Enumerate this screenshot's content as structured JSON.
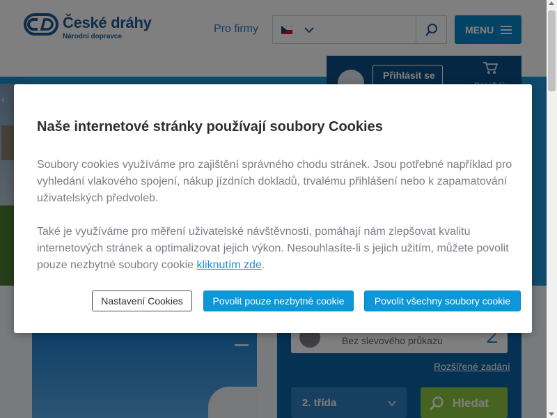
{
  "header": {
    "logo_title": "České dráhy",
    "logo_subtitle": "Národní dopravce",
    "pro_firmy": "Pro firmy",
    "language_flag": "cz-flag",
    "search_placeholder": "",
    "menu_label": "MENU"
  },
  "account": {
    "login_label": "Přihlásit se",
    "cart_label": "Dopolkák"
  },
  "search_form": {
    "passenger_label": "Bez slevového průkazu",
    "advanced_link": "Rozšířené zadání",
    "class_value": "2. třída",
    "search_button": "Hledat"
  },
  "cookie_modal": {
    "title": "Naše internetové stránky používají soubory Cookies",
    "paragraph1": "Soubory cookies využíváme pro zajištění správného chodu stránek. Jsou potřebné například pro vyhledání vlakového spojení, nákup jízdních dokladů, trvalému přihlášení nebo k zapamatování uživatelských předvoleb.",
    "paragraph2_text": "Také je využíváme pro měření uživatelské návštěvnosti, pomáhají nám zlepšovat kvalitu internetových stránek a optimalizovat jejich výkon. Nesouhlasíte-li s jejich užitím, můžete povolit pouze nezbytné soubory cookie ",
    "paragraph2_link": "kliknutím zde",
    "paragraph2_end": ".",
    "settings_button": "Nastavení Cookies",
    "necessary_button": "Povolit pouze nezbytné cookie",
    "all_button": "Povolit všechny soubory cookie"
  },
  "colors": {
    "brand_blue": "#1f5a96",
    "accent_blue": "#0c98d8",
    "search_green": "#8dc63f"
  }
}
